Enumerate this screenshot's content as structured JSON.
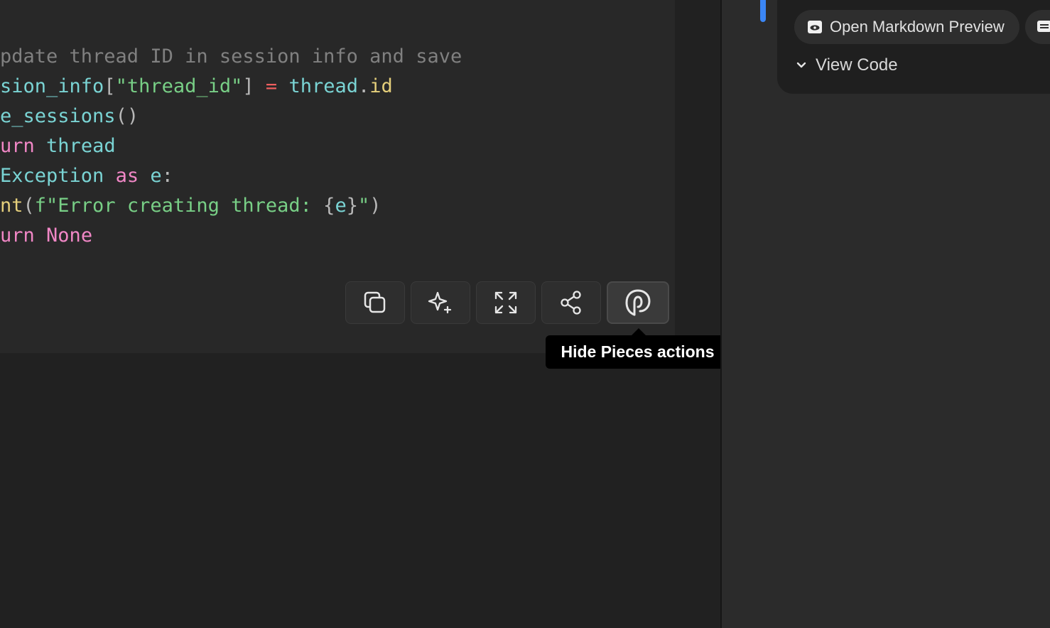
{
  "code": {
    "lines": [
      [
        {
          "t": "pdate thread ID in session info and save",
          "c": "comment"
        }
      ],
      [
        {
          "t": "sion_info",
          "c": "var"
        },
        {
          "t": "[",
          "c": "punc"
        },
        {
          "t": "\"thread_id\"",
          "c": "str"
        },
        {
          "t": "]",
          "c": "punc"
        },
        {
          "t": " ",
          "c": "punc"
        },
        {
          "t": "=",
          "c": "op"
        },
        {
          "t": " ",
          "c": "punc"
        },
        {
          "t": "thread",
          "c": "var"
        },
        {
          "t": ".",
          "c": "punc"
        },
        {
          "t": "id",
          "c": "fn"
        }
      ],
      [
        {
          "t": "e_sessions",
          "c": "var"
        },
        {
          "t": "()",
          "c": "punc"
        }
      ],
      [
        {
          "t": "urn",
          "c": "kw"
        },
        {
          "t": " ",
          "c": "punc"
        },
        {
          "t": "thread",
          "c": "var"
        }
      ],
      [
        {
          "t": "Exception",
          "c": "var"
        },
        {
          "t": " ",
          "c": "punc"
        },
        {
          "t": "as",
          "c": "kw"
        },
        {
          "t": " ",
          "c": "punc"
        },
        {
          "t": "e",
          "c": "var"
        },
        {
          "t": ":",
          "c": "punc"
        }
      ],
      [
        {
          "t": "nt",
          "c": "fn"
        },
        {
          "t": "(",
          "c": "punc"
        },
        {
          "t": "f\"Error creating thread: ",
          "c": "str"
        },
        {
          "t": "{",
          "c": "punc"
        },
        {
          "t": "e",
          "c": "var"
        },
        {
          "t": "}",
          "c": "punc"
        },
        {
          "t": "\"",
          "c": "str"
        },
        {
          "t": ")",
          "c": "punc"
        }
      ],
      [
        {
          "t": "urn",
          "c": "kw"
        },
        {
          "t": " ",
          "c": "punc"
        },
        {
          "t": "None",
          "c": "kw"
        }
      ]
    ]
  },
  "toolbar": {
    "buttons": [
      {
        "name": "copy-button",
        "icon": "copy-icon"
      },
      {
        "name": "ai-sparkle-button",
        "icon": "sparkle-icon"
      },
      {
        "name": "expand-button",
        "icon": "expand-icon"
      },
      {
        "name": "share-button",
        "icon": "share-icon"
      },
      {
        "name": "pieces-actions-button",
        "icon": "pieces-icon"
      }
    ]
  },
  "tooltip": {
    "text": "Hide Pieces actions"
  },
  "side_panel": {
    "preview_button_label": "Open Markdown Preview",
    "view_code_label": "View Code"
  },
  "colors": {
    "background": "#212121",
    "code_panel": "#282828",
    "accent_blue": "#3b86f5",
    "tooltip_bg": "#000000"
  }
}
